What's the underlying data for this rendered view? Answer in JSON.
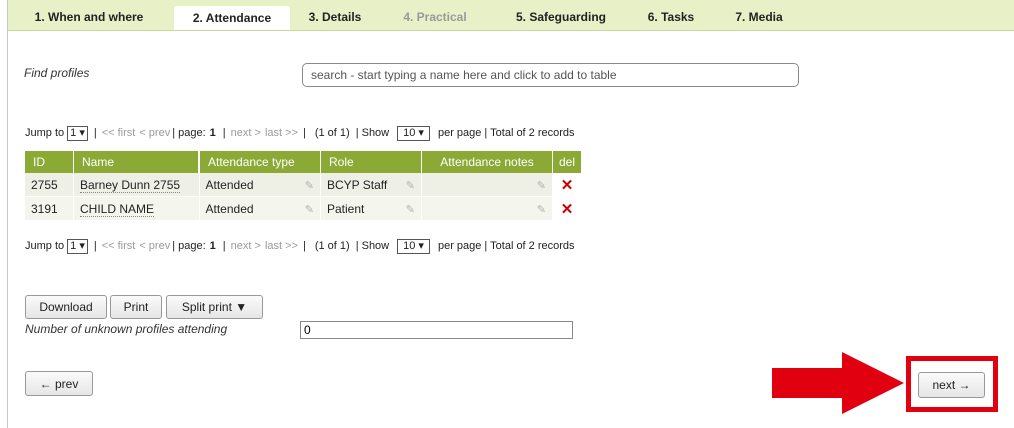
{
  "tabs": [
    {
      "label": "1. When and where"
    },
    {
      "label": "2. Attendance"
    },
    {
      "label": "3. Details"
    },
    {
      "label": "4. Practical"
    },
    {
      "label": "5. Safeguarding"
    },
    {
      "label": "6. Tasks"
    },
    {
      "label": "7. Media"
    }
  ],
  "find": {
    "label": "Find profiles",
    "placeholder": "search - start typing a name here and click to add to table"
  },
  "pager": {
    "jump_to": "Jump to",
    "jump_value": "1 ▾",
    "first": "<< first",
    "prev": "< prev",
    "page_label": "| page:",
    "page_num": "1",
    "next": "next >",
    "last": "last >>",
    "of": "(1 of 1)",
    "show": "| Show",
    "show_value": "10 ▾",
    "per_page": "per page | Total of 2 records"
  },
  "table": {
    "headers": [
      "ID",
      "Name",
      "Attendance type",
      "Role",
      "Attendance notes",
      "del"
    ],
    "rows": [
      {
        "id": "2755",
        "name": "Barney Dunn 2755",
        "type": "Attended",
        "role": "BCYP Staff",
        "notes": ""
      },
      {
        "id": "3191",
        "name": "CHILD NAME",
        "type": "Attended",
        "role": "Patient",
        "notes": ""
      }
    ]
  },
  "buttons": {
    "download": "Download",
    "print": "Print",
    "split_print": "Split print ▼",
    "prev": "← prev",
    "next": "next →"
  },
  "unknown": {
    "label": "Number of unknown profiles attending",
    "value": "0"
  },
  "colors": {
    "accent_green": "#8aaa35",
    "tab_bar": "#e8f0c8",
    "highlight_red": "#e00010"
  }
}
